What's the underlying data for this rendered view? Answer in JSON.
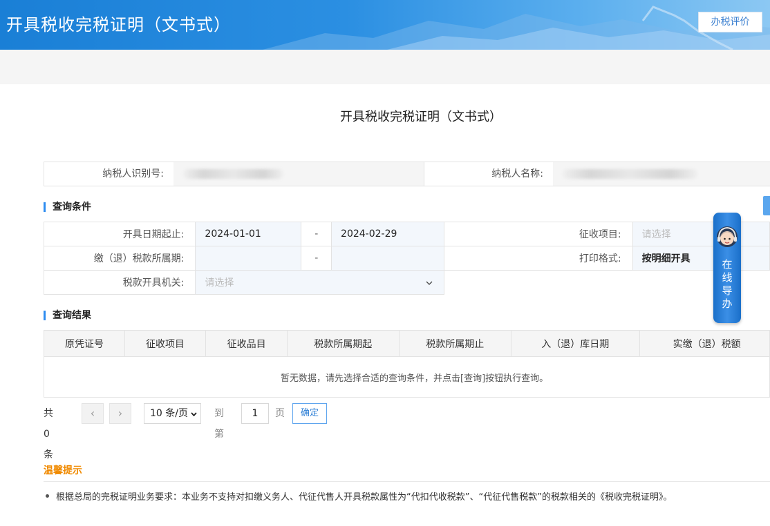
{
  "header": {
    "title": "开具税收完税证明（文书式）",
    "eval_button": "办税评价"
  },
  "page_title": "开具税收完税证明（文书式）",
  "taxpayer": {
    "id_label": "纳税人识别号:",
    "name_label": "纳税人名称:"
  },
  "query": {
    "section_title": "查询条件",
    "date_label": "开具日期起止:",
    "date_start": "2024-01-01",
    "date_end": "2024-02-29",
    "sep": "-",
    "collect_label": "征收项目:",
    "collect_placeholder": "请选择",
    "period_label": "缴（退）税款所属期:",
    "print_label": "打印格式:",
    "print_value": "按明细开具",
    "office_label": "税款开具机关:",
    "office_placeholder": "请选择"
  },
  "results": {
    "section_title": "查询结果",
    "columns": [
      "原凭证号",
      "征收项目",
      "征收品目",
      "税款所属期起",
      "税款所属期止",
      "入（退）库日期",
      "实缴（退）税额"
    ],
    "empty_text": "暂无数据，请先选择合适的查询条件，并点击[查询]按钮执行查询。"
  },
  "pager": {
    "total": "共 0 条",
    "prev": "‹",
    "next": "›",
    "page_size": "10 条/页",
    "goto_label": "到第",
    "page": "1",
    "page_unit": "页",
    "confirm": "确定"
  },
  "guide": {
    "text": "在线导办"
  },
  "tips": {
    "title": "温馨提示",
    "items": [
      "根据总局的完税证明业务要求：本业务不支持对扣缴义务人、代征代售人开具税款属性为“代扣代收税款”、“代征代售税款”的税款相关的《税收完税证明》。"
    ]
  },
  "colors": {
    "header_blue": "#1a7fd6",
    "accent": "#2d8cf0",
    "tips_orange": "#f08a00"
  }
}
